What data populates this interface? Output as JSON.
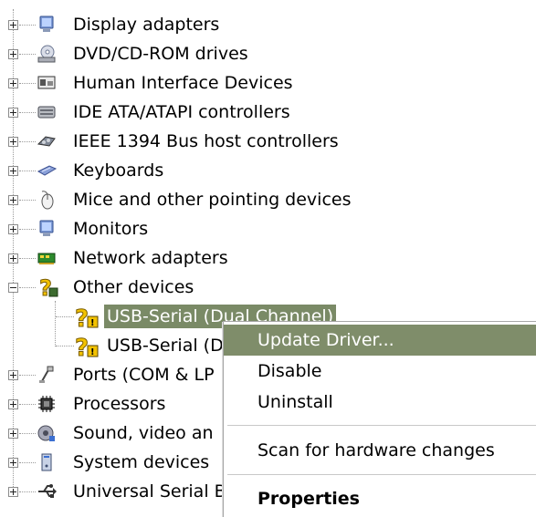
{
  "tree": {
    "items": [
      {
        "label": "Display adapters",
        "icon": "monitor-icon"
      },
      {
        "label": "DVD/CD-ROM drives",
        "icon": "cd-drive-icon"
      },
      {
        "label": "Human Interface Devices",
        "icon": "hid-icon"
      },
      {
        "label": "IDE ATA/ATAPI controllers",
        "icon": "ide-controller-icon"
      },
      {
        "label": "IEEE 1394 Bus host controllers",
        "icon": "firewire-icon"
      },
      {
        "label": "Keyboards",
        "icon": "keyboard-icon"
      },
      {
        "label": "Mice and other pointing devices",
        "icon": "mouse-icon"
      },
      {
        "label": "Monitors",
        "icon": "monitor-icon"
      },
      {
        "label": "Network adapters",
        "icon": "network-card-icon"
      },
      {
        "label": "Other devices",
        "icon": "unknown-device-icon"
      },
      {
        "label": "USB-Serial (Dual Channel)",
        "icon": "warning-device-icon"
      },
      {
        "label": "USB-Serial (D",
        "icon": "warning-device-icon"
      },
      {
        "label": "Ports (COM & LP",
        "icon": "port-icon"
      },
      {
        "label": "Processors",
        "icon": "cpu-icon"
      },
      {
        "label": "Sound, video an",
        "icon": "sound-icon"
      },
      {
        "label": "System devices",
        "icon": "computer-icon"
      },
      {
        "label": "Universal Serial B",
        "icon": "usb-icon"
      }
    ]
  },
  "context_menu": {
    "update_driver": "Update Driver...",
    "disable": "Disable",
    "uninstall": "Uninstall",
    "scan": "Scan for hardware changes",
    "properties": "Properties"
  }
}
